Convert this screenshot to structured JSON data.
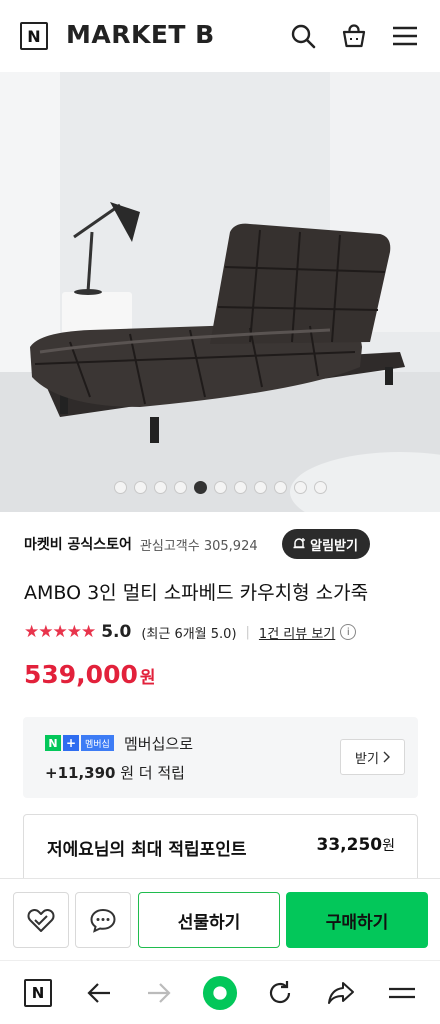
{
  "header": {
    "logo_letter": "N",
    "brand": "MARKET B",
    "icons": [
      "search-icon",
      "cart-icon",
      "menu-icon"
    ]
  },
  "hero": {
    "image": "product-photo-sofa-bed",
    "slide_count": 11,
    "active_slide": 5
  },
  "store": {
    "name": "마켓비 공식스토어",
    "meta": "관심고객수 305,924",
    "alarm_label": "알림받기"
  },
  "product": {
    "title": "AMBO 3인 멀티 소파베드 카우치형 소가죽",
    "stars": "★★★★★",
    "rating": "5.0",
    "recent_rating": "(최근 6개월 5.0)",
    "review_link": "1건 리뷰 보기",
    "price": "539,000",
    "price_unit": "원",
    "accent_color": "#e2213b"
  },
  "membership": {
    "badge_n": "N",
    "badge_plus": "+",
    "badge_label": "멤버십",
    "text": "멤버십으로",
    "points_amount": "+11,390",
    "points_suffix": "원 더 적립",
    "get_button": "받기"
  },
  "max_points": {
    "label": "저에요님의 최대 적립포인트",
    "value": "33,250",
    "unit": "원"
  },
  "buy_bar": {
    "gift_label": "선물하기",
    "purchase_label": "구매하기",
    "purchase_color": "#03c75a"
  },
  "nav_bar": {
    "logo_letter": "N",
    "icons": [
      "n-logo-icon",
      "back-arrow-icon",
      "forward-arrow-icon",
      "home-circle-icon",
      "refresh-icon",
      "share-icon",
      "menu-icon"
    ]
  }
}
